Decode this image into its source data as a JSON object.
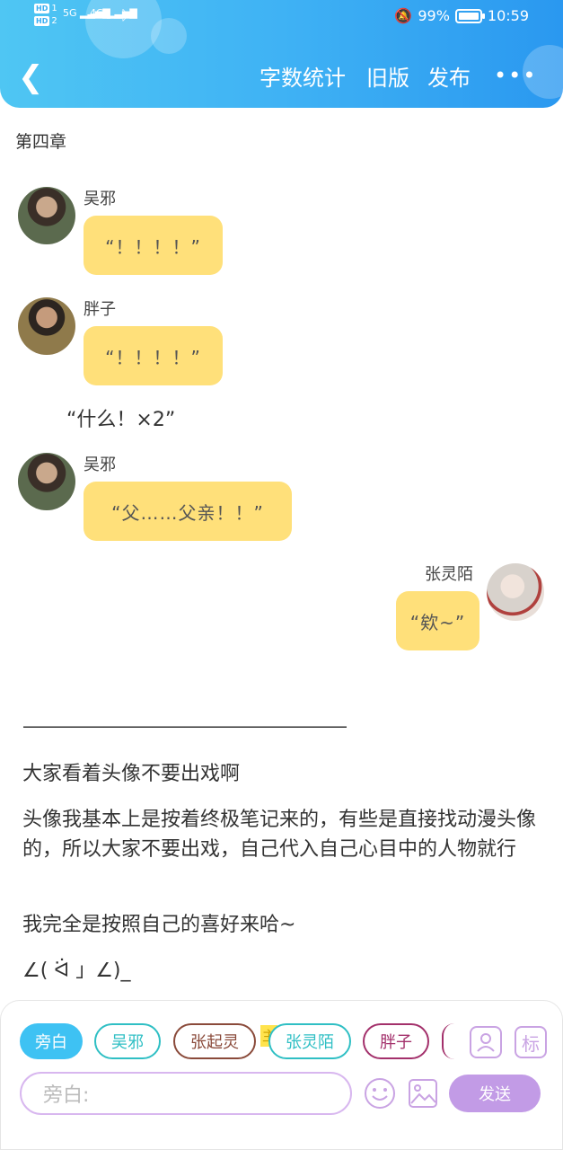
{
  "status_bar": {
    "hd1": "HD",
    "sim1": "1",
    "hd2": "HD",
    "sim2": "2",
    "net1": "5G",
    "net2": "4G",
    "battery_text": "99%",
    "battery_level": 0.99,
    "time": "10:59"
  },
  "header": {
    "word_count": "字数统计",
    "old_version": "旧版",
    "publish": "发布",
    "more": "•••"
  },
  "chapter": "第四章",
  "messages": [
    {
      "name": "吴邪",
      "text": "“！！！！”"
    },
    {
      "name": "胖子",
      "text": "“！！！！”"
    },
    {
      "narration": "“什么！×2”"
    },
    {
      "name": "吴邪",
      "text": "“父……父亲！！”"
    },
    {
      "name": "张灵陌",
      "text": "“欸~”"
    }
  ],
  "divider": "————————————————————",
  "paragraphs": [
    "大家看着头像不要出戏啊",
    "头像我基本上是按着终极笔记来的，有些是直接找动漫头像的，所以大家不要出戏，自己代入自己心目中的人物就行",
    "我完全是按照自己的喜好来哈~",
    "∠( ᐛ 」∠)_"
  ],
  "toolbar": {
    "chips": [
      "旁白",
      "吴邪",
      "张起灵",
      "张灵陌",
      "胖子"
    ],
    "main_tag": "主",
    "mark_label": "标",
    "input_placeholder": "旁白:",
    "send": "发送"
  },
  "colors": {
    "header_start": "#4fc6f3",
    "header_end": "#2a98f0",
    "bubble": "#ffe07a",
    "accent_purple": "#c29be6",
    "chip_teal": "#2fbfc4",
    "chip_brown": "#8a4a3a",
    "chip_plum": "#a3306b"
  }
}
